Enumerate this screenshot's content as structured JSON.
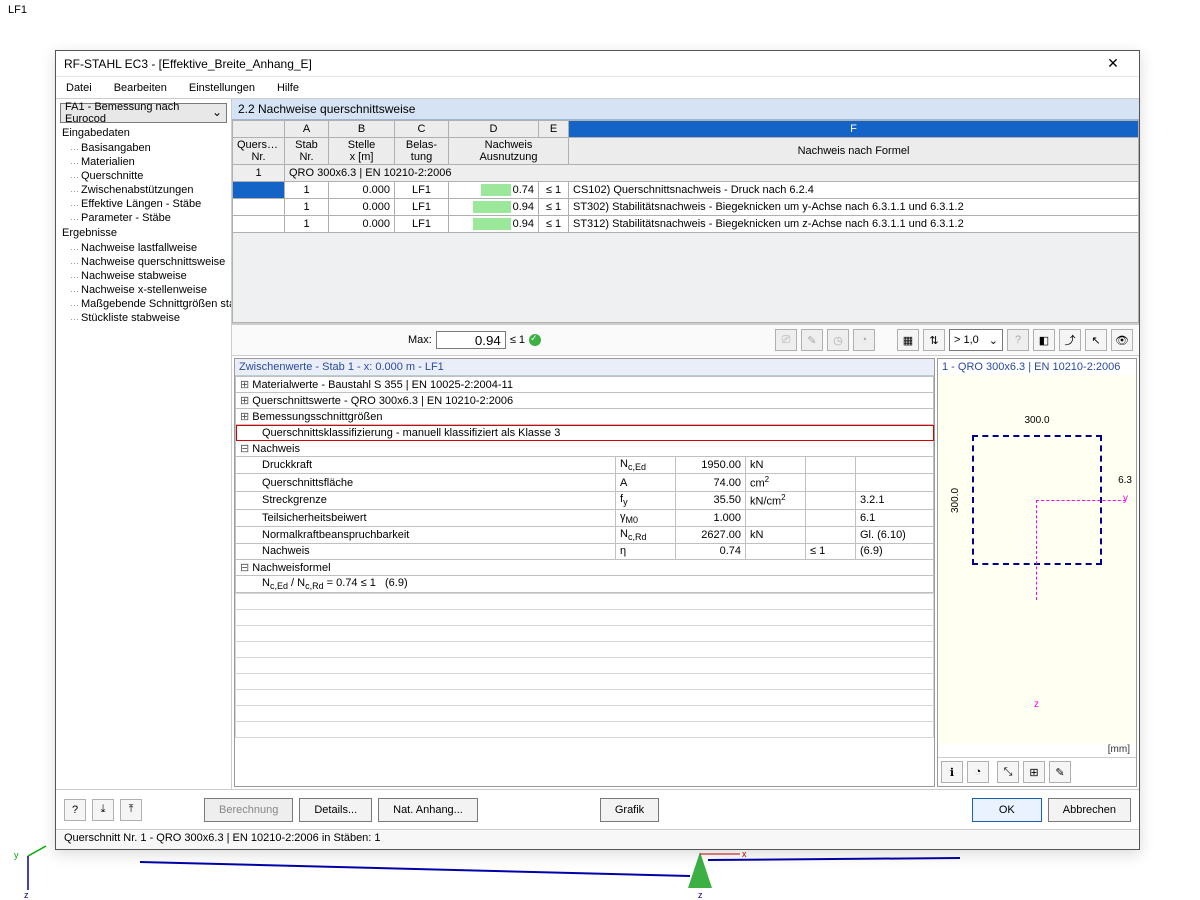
{
  "background": {
    "lf_label": "LF1"
  },
  "window": {
    "title": "RF-STAHL EC3 - [Effektive_Breite_Anhang_E]"
  },
  "menu": {
    "file": "Datei",
    "edit": "Bearbeiten",
    "settings": "Einstellungen",
    "help": "Hilfe"
  },
  "nav": {
    "combo": "FA1 - Bemessung nach Eurocod",
    "group_input": "Eingabedaten",
    "items": [
      "Basisangaben",
      "Materialien",
      "Querschnitte",
      "Zwischenabstützungen",
      "Effektive Längen - Stäbe",
      "Parameter - Stäbe"
    ],
    "group_results": "Ergebnisse",
    "ritems": [
      "Nachweise lastfallweise",
      "Nachweise querschnittsweise",
      "Nachweise stabweise",
      "Nachweise x-stellenweise",
      "Maßgebende Schnittgrößen sta",
      "Stückliste stabweise"
    ]
  },
  "table": {
    "title": "2.2 Nachweise querschnittsweise",
    "cols": {
      "A": "A",
      "B": "B",
      "C": "C",
      "D": "D",
      "E": "E",
      "F": "F"
    },
    "h2": {
      "quersch1": "Quersch.",
      "quersch2": "Nr.",
      "stab1": "Stab",
      "stab2": "Nr.",
      "stelle1": "Stelle",
      "stelle2": "x [m]",
      "belas1": "Belas-",
      "belas2": "tung",
      "nachw1": "Nachweis",
      "nachw2": "Ausnutzung",
      "formel": "Nachweis nach Formel"
    },
    "section": {
      "nr": "1",
      "label": "QRO 300x6.3 | EN 10210-2:2006"
    },
    "rows": [
      {
        "stab": "1",
        "x": "0.000",
        "lf": "LF1",
        "ratio": "0.74",
        "le": "≤ 1",
        "desc": "CS102) Querschnittsnachweis - Druck nach 6.2.4"
      },
      {
        "stab": "1",
        "x": "0.000",
        "lf": "LF1",
        "ratio": "0.94",
        "le": "≤ 1",
        "desc": "ST302) Stabilitätsnachweis - Biegeknicken um y-Achse nach 6.3.1.1 und 6.3.1.2"
      },
      {
        "stab": "1",
        "x": "0.000",
        "lf": "LF1",
        "ratio": "0.94",
        "le": "≤ 1",
        "desc": "ST312) Stabilitätsnachweis - Biegeknicken um z-Achse nach 6.3.1.1 und 6.3.1.2"
      }
    ]
  },
  "toolbar": {
    "max_label": "Max:",
    "max_value": "0.94",
    "le1": "≤ 1",
    "ratio_filter": "> 1,0"
  },
  "details": {
    "title": "Zwischenwerte - Stab 1 - x: 0.000 m - LF1",
    "nodes": [
      "Materialwerte - Baustahl S 355 | EN 10025-2:2004-11",
      "Querschnittswerte -  QRO 300x6.3 | EN 10210-2:2006",
      "Bemessungsschnittgrößen",
      "Querschnittsklassifizierung - manuell klassifiziert als Klasse 3",
      "Nachweis",
      "Nachweisformel"
    ],
    "rows": [
      {
        "label": "Druckkraft",
        "sym": "Nc,Ed",
        "val": "1950.00",
        "unit": "kN"
      },
      {
        "label": "Querschnittsfläche",
        "sym": "A",
        "val": "74.00",
        "unit": "cm²"
      },
      {
        "label": "Streckgrenze",
        "sym": "fy",
        "val": "35.50",
        "unit": "kN/cm²",
        "ref": "3.2.1"
      },
      {
        "label": "Teilsicherheitsbeiwert",
        "sym": "γM0",
        "val": "1.000",
        "ref": "6.1"
      },
      {
        "label": "Normalkraftbeanspruchbarkeit",
        "sym": "Nc,Rd",
        "val": "2627.00",
        "unit": "kN",
        "ref": "Gl. (6.10)"
      },
      {
        "label": "Nachweis",
        "sym": "η",
        "val": "0.74",
        "cond": "≤ 1",
        "ref": "(6.9)"
      }
    ],
    "formula": "Nc,Ed / Nc,Rd = 0.74 ≤ 1   (6.9)"
  },
  "profile": {
    "title": "1 - QRO 300x6.3 | EN 10210-2:2006",
    "width": "300.0",
    "height": "300.0",
    "thickness": "6.3",
    "unit": "[mm]"
  },
  "footer": {
    "calc": "Berechnung",
    "details": "Details...",
    "annex": "Nat. Anhang...",
    "graphic": "Grafik",
    "ok": "OK",
    "cancel": "Abbrechen"
  },
  "status": {
    "text": "Querschnitt Nr. 1 - QRO 300x6.3 | EN 10210-2:2006 in Stäben: 1"
  }
}
